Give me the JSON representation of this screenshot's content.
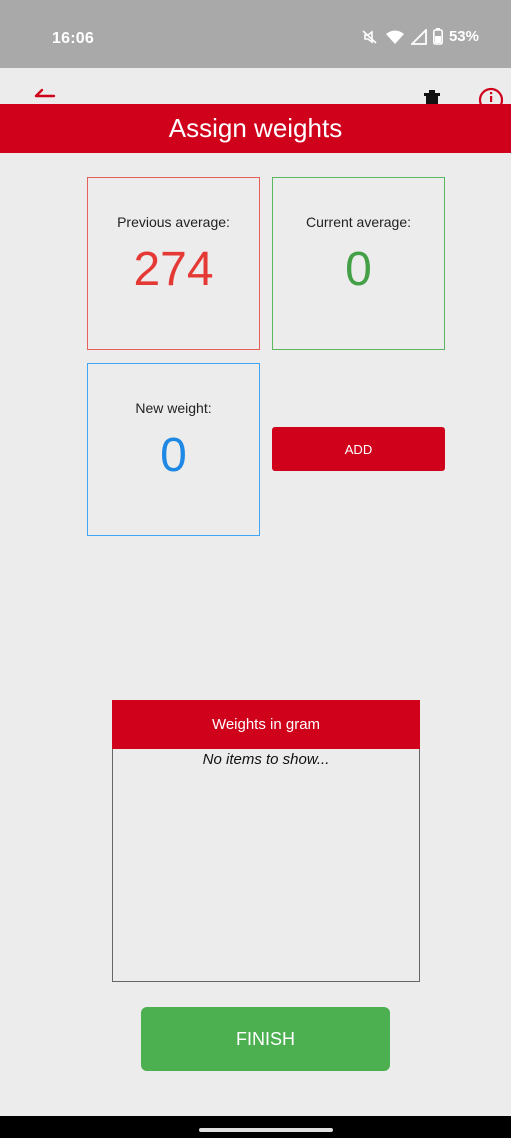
{
  "status_bar": {
    "time": "16:06",
    "battery": "53%",
    "icons": [
      "mute-icon",
      "wifi-icon",
      "signal-icon",
      "battery-icon"
    ]
  },
  "toolbar": {
    "icons": [
      "back-arrow-icon",
      "trash-icon",
      "info-icon"
    ]
  },
  "header": {
    "title": "Assign weights"
  },
  "cards": {
    "previous": {
      "label": "Previous average:",
      "value": "274"
    },
    "current": {
      "label": "Current average:",
      "value": "0"
    },
    "new_weight": {
      "label": "New weight:",
      "value": "0"
    }
  },
  "add_button": {
    "label": "ADD"
  },
  "weights_list": {
    "title": "Weights in gram",
    "empty_text": "No items to show..."
  },
  "finish_button": {
    "label": "FINISH"
  },
  "colors": {
    "brand_red": "#d0011b",
    "previous": "#e53935",
    "current": "#43a047",
    "new_weight": "#1e88e5",
    "finish": "#4caf50"
  }
}
